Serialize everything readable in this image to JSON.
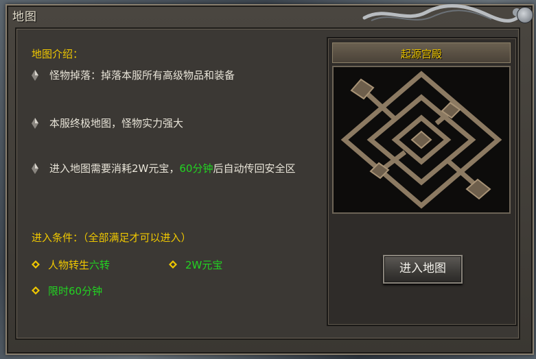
{
  "window": {
    "title": "地图"
  },
  "intro": {
    "heading": "地图介绍：",
    "items": [
      {
        "text": "怪物掉落：掉落本服所有高级物品和装备"
      },
      {
        "text": "本服终极地图，怪物实力强大"
      },
      {
        "text_before": "进入地图需要消耗2W元宝，",
        "text_highlight": "60分钟",
        "text_after": "后自动传回安全区"
      }
    ]
  },
  "conditions": {
    "heading": "进入条件：（全部满足才可以进入）",
    "items": [
      {
        "label": "人物转生",
        "value": "六转"
      },
      {
        "label": "",
        "value": "2W元宝"
      },
      {
        "label": "",
        "value": "限时60分钟"
      }
    ]
  },
  "map": {
    "name": "起源宫殿"
  },
  "enter_button": {
    "label": "进入地图"
  },
  "colors": {
    "heading": "#f0c800",
    "highlight": "#22d422",
    "text": "#e8e4d8"
  },
  "icons": [
    "dragon-ornament-icon",
    "close-icon",
    "bullet-diamond-icon",
    "condition-diamond-icon"
  ]
}
